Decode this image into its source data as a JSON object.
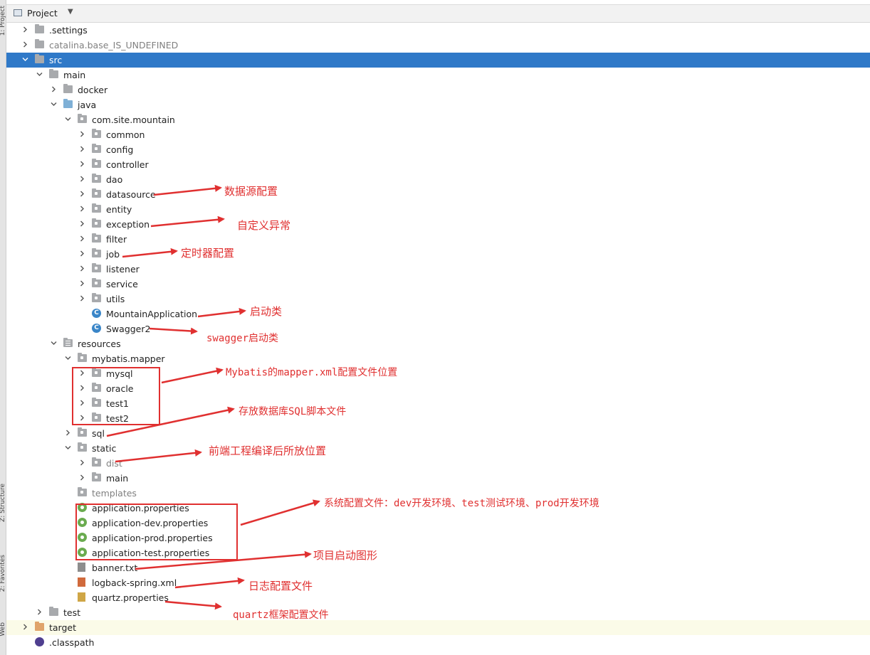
{
  "sidebar": {
    "tabs": [
      "1: Project",
      "Z: Structure",
      "2: Favorites",
      "Web"
    ]
  },
  "header": {
    "title": "Project"
  },
  "tree": [
    {
      "label": ".settings",
      "icon": "folder",
      "expanded": false
    },
    {
      "label": "catalina.base_IS_UNDEFINED",
      "icon": "folder",
      "expanded": false
    },
    {
      "label": "src",
      "icon": "folder",
      "expanded": true,
      "selected": true
    },
    {
      "label": "main",
      "icon": "folder",
      "expanded": true
    },
    {
      "label": "docker",
      "icon": "folder",
      "expanded": false
    },
    {
      "label": "java",
      "icon": "source-folder",
      "expanded": true
    },
    {
      "label": "com.site.mountain",
      "icon": "package",
      "expanded": true
    },
    {
      "label": "common",
      "icon": "package",
      "expanded": false
    },
    {
      "label": "config",
      "icon": "package",
      "expanded": false
    },
    {
      "label": "controller",
      "icon": "package",
      "expanded": false
    },
    {
      "label": "dao",
      "icon": "package",
      "expanded": false
    },
    {
      "label": "datasource",
      "icon": "package",
      "expanded": false
    },
    {
      "label": "entity",
      "icon": "package",
      "expanded": false
    },
    {
      "label": "exception",
      "icon": "package",
      "expanded": false
    },
    {
      "label": "filter",
      "icon": "package",
      "expanded": false
    },
    {
      "label": "job",
      "icon": "package",
      "expanded": false
    },
    {
      "label": "listener",
      "icon": "package",
      "expanded": false
    },
    {
      "label": "service",
      "icon": "package",
      "expanded": false
    },
    {
      "label": "utils",
      "icon": "package",
      "expanded": false
    },
    {
      "label": "MountainApplication",
      "icon": "spring-class"
    },
    {
      "label": "Swagger2",
      "icon": "class"
    },
    {
      "label": "resources",
      "icon": "resources-folder",
      "expanded": true
    },
    {
      "label": "mybatis.mapper",
      "icon": "package",
      "expanded": true
    },
    {
      "label": "mysql",
      "icon": "package",
      "expanded": false
    },
    {
      "label": "oracle",
      "icon": "package",
      "expanded": false
    },
    {
      "label": "test1",
      "icon": "package",
      "expanded": false
    },
    {
      "label": "test2",
      "icon": "package",
      "expanded": false
    },
    {
      "label": "sql",
      "icon": "package",
      "expanded": false
    },
    {
      "label": "static",
      "icon": "package",
      "expanded": true
    },
    {
      "label": "dist",
      "icon": "package",
      "expanded": false
    },
    {
      "label": "main",
      "icon": "package",
      "expanded": false
    },
    {
      "label": "templates",
      "icon": "package"
    },
    {
      "label": "application.properties",
      "icon": "spring-properties"
    },
    {
      "label": "application-dev.properties",
      "icon": "spring-properties"
    },
    {
      "label": "application-prod.properties",
      "icon": "spring-properties"
    },
    {
      "label": "application-test.properties",
      "icon": "spring-properties"
    },
    {
      "label": "banner.txt",
      "icon": "text-file"
    },
    {
      "label": "logback-spring.xml",
      "icon": "xml-file"
    },
    {
      "label": "quartz.properties",
      "icon": "properties-file"
    },
    {
      "label": "test",
      "icon": "folder",
      "expanded": false
    },
    {
      "label": "target",
      "icon": "excluded-folder",
      "expanded": false
    },
    {
      "label": ".classpath",
      "icon": "classpath-file"
    }
  ],
  "annotations": {
    "datasource": "数据源配置",
    "exception": "自定义异常",
    "job": "定时器配置",
    "main_class": "启动类",
    "swagger": "swagger启动类",
    "mapper": "Mybatis的mapper.xml配置文件位置",
    "sql": "存放数据库SQL脚本文件",
    "static": "前端工程编译后所放位置",
    "config_files": "系统配置文件：dev开发环境、test测试环境、prod开发环境",
    "banner": "项目启动图形",
    "logback": "日志配置文件",
    "quartz": "quartz框架配置文件"
  },
  "colors": {
    "selection": "#2f79c8",
    "annotation": "#e03030",
    "folder": "#a8aaad",
    "source_folder": "#7fb0d6",
    "excluded_folder": "#e0a46a"
  }
}
